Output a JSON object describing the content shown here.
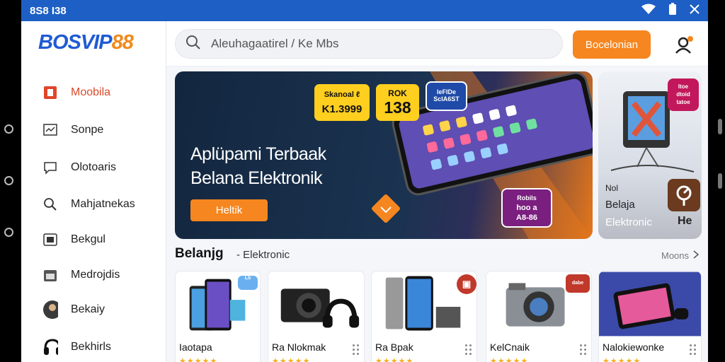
{
  "status_bar": {
    "time": "8S8 I38",
    "icons": [
      "wifi-icon",
      "battery-icon",
      "close-icon"
    ]
  },
  "brand": {
    "logo_part1": "BOSVIP",
    "logo_part2": "88",
    "primary_color": "#1f5bd4",
    "accent_color": "#f6861f"
  },
  "sidebar": {
    "items": [
      {
        "label": "Moobila",
        "icon": "mobile-icon",
        "active": true
      },
      {
        "label": "Sonpe",
        "icon": "chart-icon",
        "active": false
      },
      {
        "label": "Olotoaris",
        "icon": "chat-icon",
        "active": false
      },
      {
        "label": "Mahjatnekas",
        "icon": "search-icon",
        "active": false
      },
      {
        "label": "Bekgul",
        "icon": "device-icon",
        "active": false
      },
      {
        "label": "Medrojdis",
        "icon": "calendar-icon",
        "active": false
      },
      {
        "label": "Bekaiy",
        "icon": "avatar-icon",
        "active": false
      },
      {
        "label": "Bekhirls",
        "icon": "headphones-icon",
        "active": false
      }
    ]
  },
  "search": {
    "placeholder": "Aleuhagaatirel / Ke Mbs"
  },
  "header": {
    "primary_button": "Bocelonian",
    "user_icon": "user-settings-icon"
  },
  "hero": {
    "title_line1": "Aplüpami Terbaak",
    "title_line2": "Belana Elektronik",
    "button": "Heltik",
    "tag1_line1": "Skanoal ℓ",
    "tag1_line2": "K1.3999",
    "tag2_line1": "ROK",
    "tag2_line2": "138",
    "tag3_line1": "IeFIDe",
    "tag3_line2": "ScIA6ST",
    "tag4_line1": "Robils",
    "tag4_line2": "hoo a",
    "tag4_line3": "A8-86"
  },
  "side_promo": {
    "badge_line1": "Itoe",
    "badge_line2": "dtoid",
    "badge_line3": "tatoe",
    "line1": "Nol",
    "line2": "Belaja",
    "line3": "Elektronic",
    "corner": "He"
  },
  "section": {
    "title": "Belanjg",
    "subtitle": "- Elektronic",
    "more": "Moons"
  },
  "products": [
    {
      "name": "Iaotapa",
      "badge": "Lb"
    },
    {
      "name": "Ra Nlokmak",
      "badge": ""
    },
    {
      "name": "Ra Bpak",
      "badge": "▣"
    },
    {
      "name": "KelCnaik",
      "badge": "dabe"
    },
    {
      "name": "Nalokiewonke",
      "badge": ""
    }
  ]
}
